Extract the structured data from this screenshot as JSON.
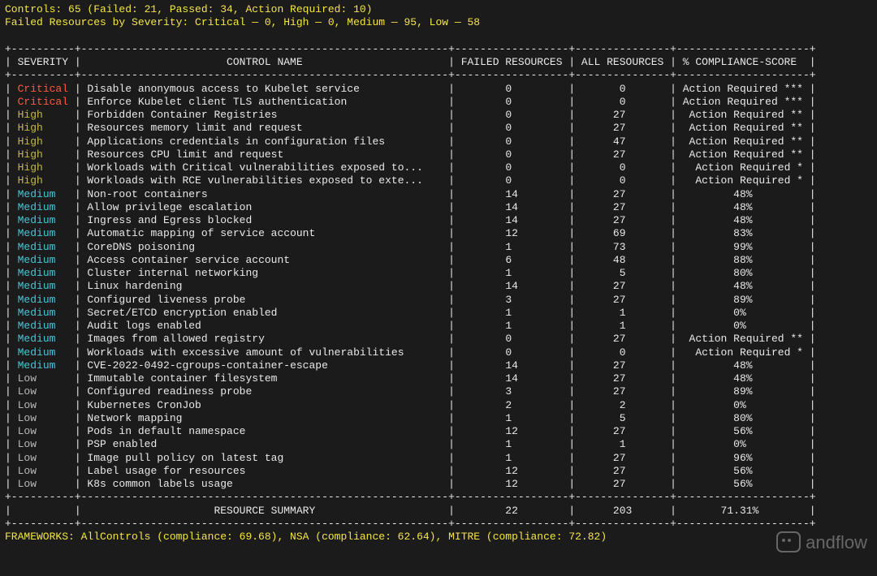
{
  "header": {
    "controls_label": "Controls",
    "controls_total": "65",
    "failed_label": "Failed",
    "failed": "21",
    "passed_label": "Passed",
    "passed": "34",
    "action_req_label": "Action Required",
    "action_req": "10",
    "by_sev_label": "Failed Resources by Severity",
    "critical_label": "Critical",
    "critical": "0",
    "high_label": "High",
    "high": "0",
    "medium_label": "Medium",
    "medium": "95",
    "low_label": "Low",
    "low": "58"
  },
  "columns": {
    "severity": "SEVERITY",
    "control_name": "CONTROL NAME",
    "failed_resources": "FAILED RESOURCES",
    "all_resources": "ALL RESOURCES",
    "compliance": "% COMPLIANCE-SCORE"
  },
  "rows": [
    {
      "severity": "Critical",
      "name": "Disable anonymous access to Kubelet service",
      "failed": "0",
      "all": "0",
      "score": "Action Required ***"
    },
    {
      "severity": "Critical",
      "name": "Enforce Kubelet client TLS authentication",
      "failed": "0",
      "all": "0",
      "score": "Action Required ***"
    },
    {
      "severity": "High",
      "name": "Forbidden Container Registries",
      "failed": "0",
      "all": "27",
      "score": "Action Required **"
    },
    {
      "severity": "High",
      "name": "Resources memory limit and request",
      "failed": "0",
      "all": "27",
      "score": "Action Required **"
    },
    {
      "severity": "High",
      "name": "Applications credentials in configuration files",
      "failed": "0",
      "all": "47",
      "score": "Action Required **"
    },
    {
      "severity": "High",
      "name": "Resources CPU limit and request",
      "failed": "0",
      "all": "27",
      "score": "Action Required **"
    },
    {
      "severity": "High",
      "name": "Workloads with Critical vulnerabilities exposed to...",
      "failed": "0",
      "all": "0",
      "score": "Action Required *"
    },
    {
      "severity": "High",
      "name": "Workloads with RCE vulnerabilities exposed to exte...",
      "failed": "0",
      "all": "0",
      "score": "Action Required *"
    },
    {
      "severity": "Medium",
      "name": "Non-root containers",
      "failed": "14",
      "all": "27",
      "score": "48%"
    },
    {
      "severity": "Medium",
      "name": "Allow privilege escalation",
      "failed": "14",
      "all": "27",
      "score": "48%"
    },
    {
      "severity": "Medium",
      "name": "Ingress and Egress blocked",
      "failed": "14",
      "all": "27",
      "score": "48%"
    },
    {
      "severity": "Medium",
      "name": "Automatic mapping of service account",
      "failed": "12",
      "all": "69",
      "score": "83%"
    },
    {
      "severity": "Medium",
      "name": "CoreDNS poisoning",
      "failed": "1",
      "all": "73",
      "score": "99%"
    },
    {
      "severity": "Medium",
      "name": "Access container service account",
      "failed": "6",
      "all": "48",
      "score": "88%"
    },
    {
      "severity": "Medium",
      "name": "Cluster internal networking",
      "failed": "1",
      "all": "5",
      "score": "80%"
    },
    {
      "severity": "Medium",
      "name": "Linux hardening",
      "failed": "14",
      "all": "27",
      "score": "48%"
    },
    {
      "severity": "Medium",
      "name": "Configured liveness probe",
      "failed": "3",
      "all": "27",
      "score": "89%"
    },
    {
      "severity": "Medium",
      "name": "Secret/ETCD encryption enabled",
      "failed": "1",
      "all": "1",
      "score": "0%"
    },
    {
      "severity": "Medium",
      "name": "Audit logs enabled",
      "failed": "1",
      "all": "1",
      "score": "0%"
    },
    {
      "severity": "Medium",
      "name": "Images from allowed registry",
      "failed": "0",
      "all": "27",
      "score": "Action Required **"
    },
    {
      "severity": "Medium",
      "name": "Workloads with excessive amount of vulnerabilities",
      "failed": "0",
      "all": "0",
      "score": "Action Required *"
    },
    {
      "severity": "Medium",
      "name": "CVE-2022-0492-cgroups-container-escape",
      "failed": "14",
      "all": "27",
      "score": "48%"
    },
    {
      "severity": "Low",
      "name": "Immutable container filesystem",
      "failed": "14",
      "all": "27",
      "score": "48%"
    },
    {
      "severity": "Low",
      "name": "Configured readiness probe",
      "failed": "3",
      "all": "27",
      "score": "89%"
    },
    {
      "severity": "Low",
      "name": "Kubernetes CronJob",
      "failed": "2",
      "all": "2",
      "score": "0%"
    },
    {
      "severity": "Low",
      "name": "Network mapping",
      "failed": "1",
      "all": "5",
      "score": "80%"
    },
    {
      "severity": "Low",
      "name": "Pods in default namespace",
      "failed": "12",
      "all": "27",
      "score": "56%"
    },
    {
      "severity": "Low",
      "name": "PSP enabled",
      "failed": "1",
      "all": "1",
      "score": "0%"
    },
    {
      "severity": "Low",
      "name": "Image pull policy on latest tag",
      "failed": "1",
      "all": "27",
      "score": "96%"
    },
    {
      "severity": "Low",
      "name": "Label usage for resources",
      "failed": "12",
      "all": "27",
      "score": "56%"
    },
    {
      "severity": "Low",
      "name": "K8s common labels usage",
      "failed": "12",
      "all": "27",
      "score": "56%"
    }
  ],
  "summary": {
    "label": "RESOURCE SUMMARY",
    "failed": "22",
    "all": "203",
    "score": "71.31%"
  },
  "frameworks": {
    "label": "FRAMEWORKS",
    "allcontrols_name": "AllControls",
    "allcontrols_comp": "69.68",
    "nsa_name": "NSA",
    "nsa_comp": "62.64",
    "mitre_name": "MITRE",
    "mitre_comp": "72.82",
    "compliance_word": "compliance"
  },
  "watermark": "andflow",
  "layout": {
    "w_sev": 10,
    "w_name": 58,
    "w_failed": 18,
    "w_all": 15,
    "w_score": 21
  }
}
